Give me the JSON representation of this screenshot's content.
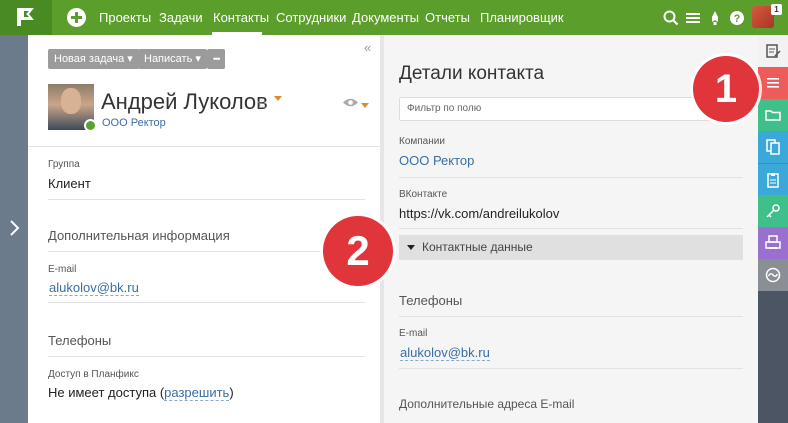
{
  "nav": {
    "items": [
      "Проекты",
      "Задачи",
      "Контакты",
      "Сотрудники",
      "Документы",
      "Отчеты",
      "Планировщик"
    ],
    "active": "Контакты",
    "avatar_badge": "1"
  },
  "toolbar": {
    "new_task": "Новая задача",
    "write": "Написать",
    "more": "•••",
    "collapse": "«"
  },
  "contact": {
    "name": "Андрей Луколов",
    "company": "ООО Ректор"
  },
  "left_fields": {
    "group_label": "Группа",
    "group_value": "Клиент",
    "extra_info": "Дополнительная информация",
    "email_label": "E-mail",
    "email_value": "alukolov@bk.ru",
    "phones": "Телефоны",
    "access_label": "Доступ в Планфикс",
    "access_value": "Не имеет доступа (",
    "access_link": "разрешить",
    "access_close": ")"
  },
  "details": {
    "title": "Детали контакта",
    "filter_placeholder": "Фильтр по полю",
    "companies_label": "Компании",
    "companies_value": "ООО Ректор",
    "vk_label": "ВКонтакте",
    "vk_value": "https://vk.com/andreilukolov",
    "contact_data": "Контактные данные",
    "phones": "Телефоны",
    "email_label": "E-mail",
    "email_value": "alukolov@bk.ru",
    "extra_emails": "Дополнительные адреса E-mail"
  },
  "markers": {
    "one": "1",
    "two": "2"
  },
  "colors": {
    "topbar": "#5c9e2c",
    "link": "#3a6ea5",
    "marker": "#e0353a",
    "sidebar_buttons": [
      "#f2f2f2",
      "#ef5b5b",
      "#3fbf8a",
      "#3aa8d8",
      "#3aa8d8",
      "#3fbf8a",
      "#9b6fd0",
      "#8a8f96"
    ]
  }
}
